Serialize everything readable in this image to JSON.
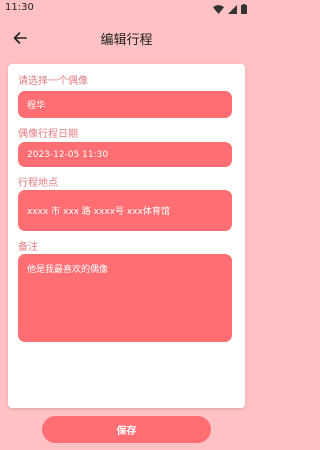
{
  "status_bar": {
    "time": "11:30",
    "icons": [
      "wifi-icon",
      "cellular-signal-icon",
      "battery-icon"
    ]
  },
  "app_bar": {
    "back_icon": "arrow-left-icon",
    "title": "编辑行程"
  },
  "form": {
    "idol": {
      "label": "请选择一个偶像",
      "value": "程华"
    },
    "date": {
      "label": "偶像行程日期",
      "value": "2023-12-05 11:30"
    },
    "location": {
      "label": "行程地点",
      "value": "xxxx 市 xxx 路 xxxx号 xxx体育馆"
    },
    "note": {
      "label": "备注",
      "value": "他是我最喜欢的偶像"
    }
  },
  "save_button": {
    "label": "保存"
  },
  "colors": {
    "page_background": "#FFC1C4",
    "accent": "#FF6E73",
    "label_text": "#E47C80",
    "card_background": "#FFFFFF"
  }
}
